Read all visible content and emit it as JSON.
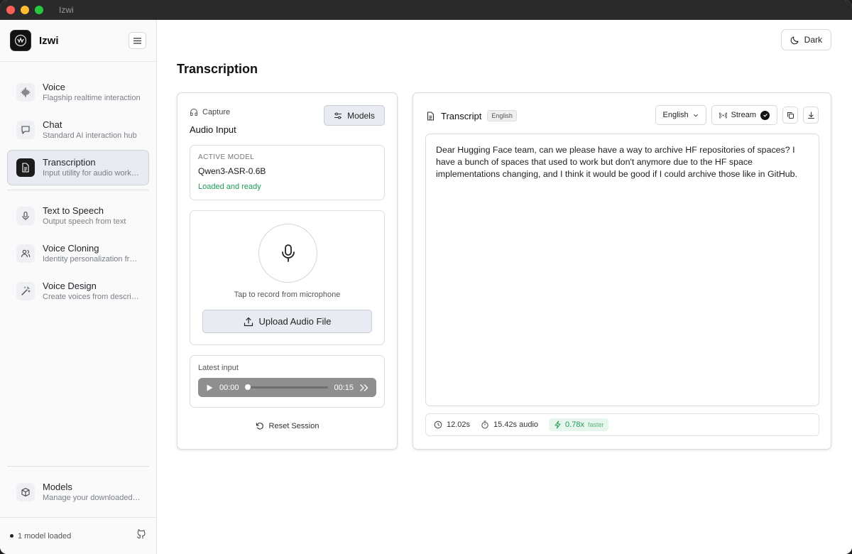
{
  "window": {
    "title": "Izwi"
  },
  "brand": {
    "name": "Izwi"
  },
  "nav": {
    "items": [
      {
        "label": "Voice",
        "sub": "Flagship realtime interaction"
      },
      {
        "label": "Chat",
        "sub": "Standard AI interaction hub"
      },
      {
        "label": "Transcription",
        "sub": "Input utility for audio workflows"
      },
      {
        "label": "Text to Speech",
        "sub": "Output speech from text"
      },
      {
        "label": "Voice Cloning",
        "sub": "Identity personalization from samples"
      },
      {
        "label": "Voice Design",
        "sub": "Create voices from descriptions"
      }
    ],
    "models": {
      "label": "Models",
      "sub": "Manage your downloaded models"
    }
  },
  "footer": {
    "status": "1 model loaded"
  },
  "header": {
    "theme_button": "Dark"
  },
  "page": {
    "title": "Transcription"
  },
  "capture": {
    "section_label": "Capture",
    "title": "Audio Input",
    "models_button": "Models",
    "active_model": {
      "label": "ACTIVE MODEL",
      "value": "Qwen3-ASR-0.6B",
      "status": "Loaded and ready"
    },
    "record_hint": "Tap to record from microphone",
    "upload_button": "Upload Audio File",
    "latest": {
      "label": "Latest input",
      "current_time": "00:00",
      "duration": "00:15",
      "progress": 0
    },
    "reset_button": "Reset Session"
  },
  "transcript": {
    "title": "Transcript",
    "language_badge": "English",
    "language_select": "English",
    "stream_label": "Stream",
    "text": "Dear Hugging Face team, can we please have a way to archive HF repositories of spaces? I have a bunch of spaces that used to work but don't anymore due to the HF space implementations changing, and I think it would be good if I could archive those like in GitHub.",
    "stats": {
      "processing_time": "12.02s",
      "audio_length": "15.42s audio",
      "speed": "0.78x",
      "speed_label": "faster"
    }
  }
}
